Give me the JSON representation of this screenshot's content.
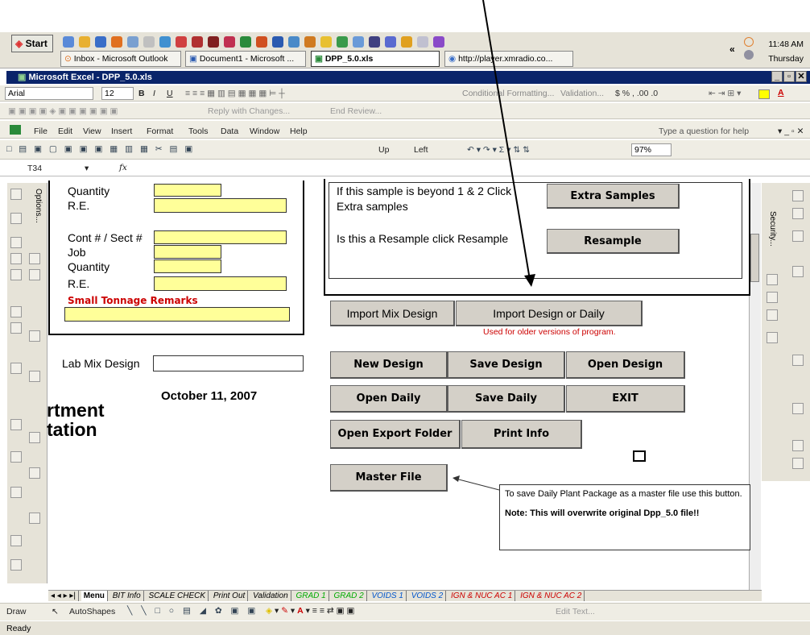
{
  "taskbar": {
    "start_label": "Start",
    "items": [
      {
        "label": "Inbox - Microsoft Outlook"
      },
      {
        "label": "Document1 - Microsoft ..."
      },
      {
        "label": "DPP_5.0.xls"
      },
      {
        "label": "http://player.xmradio.co..."
      }
    ],
    "time": "11:48 AM",
    "day": "Thursday",
    "chevron": "«"
  },
  "window": {
    "title": "Microsoft Excel - DPP_5.0.xls",
    "min": "_",
    "max": "▫",
    "close": "✕"
  },
  "format_toolbar": {
    "font": "Arial",
    "size": "12",
    "conditional": "Conditional Formatting...",
    "validation": "Validation...",
    "symbols": "$ % , .00 .0"
  },
  "review_toolbar": {
    "reply": "Reply with Changes...",
    "end": "End Review..."
  },
  "menu": {
    "items": [
      "File",
      "Edit",
      "View",
      "Insert",
      "Format",
      "Tools",
      "Data",
      "Window",
      "Help"
    ],
    "help_box": "Type a question for help"
  },
  "standard_toolbar": {
    "zoom": "97%",
    "up": "Up",
    "left": "Left"
  },
  "name_box": "T34",
  "fx": "fx",
  "left_panel": {
    "rows_top": [
      "Quantity",
      "R.E."
    ],
    "rows_mid": [
      "Cont # / Sect #",
      "Job",
      "Quantity",
      "R.E."
    ],
    "remarks": "Small Tonnage Remarks",
    "lab_mix": "Lab Mix Design",
    "date": "October 11, 2007",
    "dept_line1": "rtment",
    "dept_line2": "tation",
    "options_label": "Options...",
    "security_label": "Security..."
  },
  "samples": {
    "extra_text_1": "If this sample is beyond 1 & 2 Click",
    "extra_text_2": "Extra samples",
    "extra_button": "Extra Samples",
    "resample_text": "Is this a Resample click Resample",
    "resample_button": "Resample"
  },
  "buttons": {
    "import_mix": "Import Mix Design",
    "import_design": "Import Design or Daily",
    "import_note": "Used for older versions of program.",
    "new_design": "New Design",
    "save_design": "Save Design",
    "open_design": "Open Design",
    "open_daily": "Open Daily",
    "save_daily": "Save Daily",
    "exit": "EXIT",
    "open_export": "Open Export Folder",
    "print_info": "Print Info",
    "master_file": "Master File"
  },
  "callout": {
    "line1": "To save Daily Plant Package as a master file use this button.",
    "line2": "Note: This will overwrite original Dpp_5.0 file!!"
  },
  "sheet_tabs": [
    {
      "label": "Menu",
      "cls": "cur"
    },
    {
      "label": "BIT Info",
      "cls": ""
    },
    {
      "label": "SCALE CHECK",
      "cls": ""
    },
    {
      "label": "Print Out",
      "cls": ""
    },
    {
      "label": "Validation",
      "cls": ""
    },
    {
      "label": "GRAD 1",
      "cls": "green"
    },
    {
      "label": "GRAD 2",
      "cls": "green"
    },
    {
      "label": "VOIDS 1",
      "cls": "bl"
    },
    {
      "label": "VOIDS 2",
      "cls": "bl"
    },
    {
      "label": "IGN & NUC AC 1",
      "cls": "red"
    },
    {
      "label": "IGN & NUC AC 2",
      "cls": "red"
    }
  ],
  "sheet_nav": "◂ ◂ ▸ ▸|",
  "draw_toolbar": {
    "draw": "Draw",
    "autoshapes": "AutoShapes",
    "edit_text": "Edit Text..."
  },
  "status": "Ready",
  "colors": {
    "title": "#0a246a",
    "yellow": "#ffff99",
    "red": "#cc0000",
    "button": "#d4d0c8"
  }
}
